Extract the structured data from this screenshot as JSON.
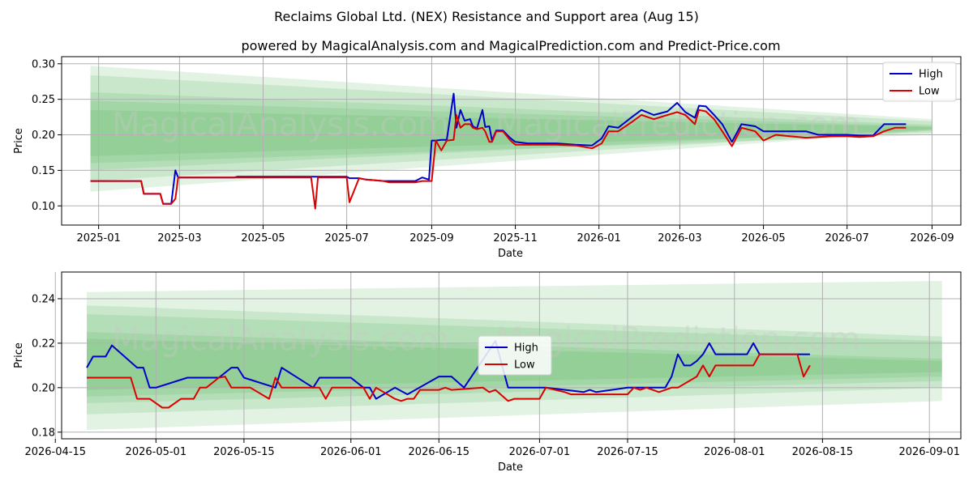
{
  "title": "Reclaims Global Ltd. (NEX) Resistance and Support area (Aug 15)",
  "subtitle": "powered by MagicalAnalysis.com and MagicalPrediction.com and Predict-Price.com",
  "watermarks": [
    "MagicalAnalysis.com",
    "MagicalPrediction.com"
  ],
  "colors": {
    "high": "#0000cc",
    "low": "#dd0000",
    "band": "#4caf50",
    "grid": "#b0b0b0"
  },
  "chart_data": [
    {
      "type": "line",
      "xlabel": "Date",
      "ylabel": "Price",
      "xlim": [
        "2024-12-05",
        "2026-09-22"
      ],
      "ylim": [
        0.073,
        0.31
      ],
      "x_ticks": [
        "2025-01",
        "2025-03",
        "2025-05",
        "2025-07",
        "2025-09",
        "2025-11",
        "2026-01",
        "2026-03",
        "2026-05",
        "2026-07",
        "2026-09"
      ],
      "y_ticks": [
        0.1,
        0.15,
        0.2,
        0.25,
        0.3
      ],
      "y_tick_labels": [
        "0.10",
        "0.15",
        "0.20",
        "0.25",
        "0.30"
      ],
      "grid": true,
      "legend": {
        "position": "top-right",
        "entries": [
          "High",
          "Low"
        ]
      },
      "bands": {
        "x": [
          "2024-12-26",
          "2026-09-01"
        ],
        "upper": [
          [
            0.297,
            0.222
          ],
          [
            0.284,
            0.219
          ],
          [
            0.26,
            0.214
          ],
          [
            0.248,
            0.212
          ],
          [
            0.235,
            0.211
          ]
        ],
        "lower": [
          [
            0.12,
            0.206
          ],
          [
            0.135,
            0.207
          ],
          [
            0.15,
            0.208
          ],
          [
            0.16,
            0.2
          ],
          [
            0.17,
            0.203
          ]
        ]
      },
      "series": [
        {
          "name": "High",
          "x": [
            "2024-12-26",
            "2025-02-01",
            "2025-02-03",
            "2025-02-15",
            "2025-02-17",
            "2025-02-23",
            "2025-02-26",
            "2025-02-28",
            "2025-04-10",
            "2025-04-12",
            "2025-06-05",
            "2025-06-08",
            "2025-06-10",
            "2025-07-01",
            "2025-07-03",
            "2025-07-10",
            "2025-07-15",
            "2025-07-28",
            "2025-08-01",
            "2025-08-20",
            "2025-08-25",
            "2025-08-30",
            "2025-09-01",
            "2025-09-04",
            "2025-09-08",
            "2025-09-12",
            "2025-09-17",
            "2025-09-19",
            "2025-09-22",
            "2025-09-25",
            "2025-09-29",
            "2025-10-01",
            "2025-10-04",
            "2025-10-08",
            "2025-10-10",
            "2025-10-13",
            "2025-10-15",
            "2025-10-18",
            "2025-10-23",
            "2025-10-28",
            "2025-11-01",
            "2025-11-10",
            "2025-11-20",
            "2025-12-01",
            "2025-12-15",
            "2025-12-27",
            "2026-01-03",
            "2026-01-08",
            "2026-01-15",
            "2026-01-25",
            "2026-02-01",
            "2026-02-10",
            "2026-02-20",
            "2026-02-27",
            "2026-03-05",
            "2026-03-12",
            "2026-03-15",
            "2026-03-20",
            "2026-03-26",
            "2026-04-01",
            "2026-04-08",
            "2026-04-15",
            "2026-04-25",
            "2026-05-01",
            "2026-05-10",
            "2026-05-20",
            "2026-06-01",
            "2026-06-10",
            "2026-06-20",
            "2026-07-01",
            "2026-07-10",
            "2026-07-20",
            "2026-07-28",
            "2026-08-05",
            "2026-08-10",
            "2026-08-13"
          ],
          "y": [
            0.135,
            0.135,
            0.117,
            0.117,
            0.103,
            0.103,
            0.15,
            0.14,
            0.14,
            0.141,
            0.141,
            0.141,
            0.141,
            0.141,
            0.139,
            0.139,
            0.137,
            0.135,
            0.135,
            0.135,
            0.14,
            0.137,
            0.192,
            0.192,
            0.193,
            0.193,
            0.258,
            0.21,
            0.235,
            0.22,
            0.222,
            0.212,
            0.209,
            0.235,
            0.211,
            0.212,
            0.192,
            0.206,
            0.206,
            0.196,
            0.19,
            0.188,
            0.188,
            0.188,
            0.186,
            0.185,
            0.195,
            0.212,
            0.21,
            0.225,
            0.235,
            0.228,
            0.233,
            0.245,
            0.232,
            0.224,
            0.241,
            0.24,
            0.228,
            0.215,
            0.19,
            0.215,
            0.212,
            0.205,
            0.205,
            0.205,
            0.205,
            0.2,
            0.2,
            0.2,
            0.199,
            0.199,
            0.215,
            0.215,
            0.215,
            0.215
          ]
        },
        {
          "name": "Low",
          "x": [
            "2024-12-26",
            "2025-02-01",
            "2025-02-03",
            "2025-02-15",
            "2025-02-17",
            "2025-02-23",
            "2025-02-26",
            "2025-02-28",
            "2025-04-10",
            "2025-04-12",
            "2025-06-05",
            "2025-06-08",
            "2025-06-10",
            "2025-07-01",
            "2025-07-03",
            "2025-07-10",
            "2025-07-15",
            "2025-07-28",
            "2025-08-01",
            "2025-08-20",
            "2025-08-25",
            "2025-08-30",
            "2025-09-01",
            "2025-09-04",
            "2025-09-08",
            "2025-09-12",
            "2025-09-17",
            "2025-09-19",
            "2025-09-22",
            "2025-09-25",
            "2025-09-29",
            "2025-10-01",
            "2025-10-04",
            "2025-10-08",
            "2025-10-10",
            "2025-10-13",
            "2025-10-15",
            "2025-10-18",
            "2025-10-23",
            "2025-10-28",
            "2025-11-01",
            "2025-11-10",
            "2025-11-20",
            "2025-12-01",
            "2025-12-15",
            "2025-12-27",
            "2026-01-03",
            "2026-01-08",
            "2026-01-15",
            "2026-01-25",
            "2026-02-01",
            "2026-02-10",
            "2026-02-20",
            "2026-02-27",
            "2026-03-05",
            "2026-03-12",
            "2026-03-15",
            "2026-03-20",
            "2026-03-26",
            "2026-04-01",
            "2026-04-08",
            "2026-04-15",
            "2026-04-25",
            "2026-05-01",
            "2026-05-10",
            "2026-05-20",
            "2026-06-01",
            "2026-06-10",
            "2026-06-20",
            "2026-07-01",
            "2026-07-10",
            "2026-07-20",
            "2026-07-28",
            "2026-08-05",
            "2026-08-10",
            "2026-08-13"
          ],
          "y": [
            0.135,
            0.135,
            0.117,
            0.117,
            0.103,
            0.103,
            0.11,
            0.14,
            0.14,
            0.14,
            0.14,
            0.096,
            0.14,
            0.14,
            0.105,
            0.139,
            0.137,
            0.135,
            0.133,
            0.133,
            0.135,
            0.135,
            0.135,
            0.192,
            0.178,
            0.192,
            0.193,
            0.228,
            0.21,
            0.215,
            0.215,
            0.21,
            0.208,
            0.21,
            0.205,
            0.19,
            0.19,
            0.205,
            0.205,
            0.193,
            0.186,
            0.186,
            0.186,
            0.186,
            0.185,
            0.181,
            0.188,
            0.205,
            0.205,
            0.218,
            0.228,
            0.222,
            0.228,
            0.232,
            0.228,
            0.215,
            0.235,
            0.233,
            0.222,
            0.205,
            0.184,
            0.21,
            0.205,
            0.192,
            0.2,
            0.198,
            0.196,
            0.197,
            0.198,
            0.198,
            0.197,
            0.198,
            0.205,
            0.21,
            0.21,
            0.21
          ]
        }
      ]
    },
    {
      "type": "line",
      "xlabel": "Date",
      "ylabel": "Price",
      "xlim": [
        "2026-04-16",
        "2026-09-06"
      ],
      "ylim": [
        0.177,
        0.252
      ],
      "x_ticks": [
        "2026-04-15",
        "2026-05-01",
        "2026-05-15",
        "2026-06-01",
        "2026-06-15",
        "2026-07-01",
        "2026-07-15",
        "2026-08-01",
        "2026-08-15",
        "2026-09-01"
      ],
      "y_ticks": [
        0.18,
        0.2,
        0.22,
        0.24
      ],
      "y_tick_labels": [
        "0.18",
        "0.20",
        "0.22",
        "0.24"
      ],
      "grid": true,
      "legend": {
        "position": "center",
        "entries": [
          "High",
          "Low"
        ]
      },
      "bands": {
        "x": [
          "2026-04-20",
          "2026-09-03"
        ],
        "upper": [
          [
            0.243,
            0.248
          ],
          [
            0.237,
            0.223
          ],
          [
            0.233,
            0.221
          ],
          [
            0.225,
            0.213
          ],
          [
            0.222,
            0.212
          ]
        ],
        "lower": [
          [
            0.199,
            0.207
          ],
          [
            0.196,
            0.205
          ],
          [
            0.193,
            0.203
          ],
          [
            0.188,
            0.2
          ],
          [
            0.181,
            0.194
          ]
        ]
      },
      "series": [
        {
          "name": "High",
          "x": [
            "2026-04-20",
            "2026-04-21",
            "2026-04-23",
            "2026-04-24",
            "2026-04-28",
            "2026-04-29",
            "2026-04-30",
            "2026-05-01",
            "2026-05-06",
            "2026-05-11",
            "2026-05-13",
            "2026-05-14",
            "2026-05-15",
            "2026-05-20",
            "2026-05-21",
            "2026-05-26",
            "2026-05-27",
            "2026-06-01",
            "2026-06-03",
            "2026-06-04",
            "2026-06-05",
            "2026-06-08",
            "2026-06-10",
            "2026-06-15",
            "2026-06-17",
            "2026-06-19",
            "2026-06-24",
            "2026-06-26",
            "2026-07-02",
            "2026-07-08",
            "2026-07-09",
            "2026-07-10",
            "2026-07-15",
            "2026-07-16",
            "2026-07-20",
            "2026-07-21",
            "2026-07-22",
            "2026-07-23",
            "2026-07-24",
            "2026-07-25",
            "2026-07-26",
            "2026-07-27",
            "2026-07-28",
            "2026-07-29",
            "2026-08-03",
            "2026-08-04",
            "2026-08-05",
            "2026-08-06",
            "2026-08-10",
            "2026-08-11",
            "2026-08-12",
            "2026-08-13"
          ],
          "y": [
            0.209,
            0.214,
            0.214,
            0.219,
            0.209,
            0.209,
            0.2,
            0.2,
            0.2045,
            0.2045,
            0.209,
            0.209,
            0.2045,
            0.2,
            0.209,
            0.2,
            0.2045,
            0.2045,
            0.2,
            0.2,
            0.195,
            0.2,
            0.197,
            0.205,
            0.205,
            0.2,
            0.221,
            0.2,
            0.2,
            0.198,
            0.199,
            0.198,
            0.2,
            0.2,
            0.2,
            0.2,
            0.205,
            0.215,
            0.21,
            0.21,
            0.212,
            0.215,
            0.22,
            0.215,
            0.215,
            0.22,
            0.215,
            0.215,
            0.215,
            0.215,
            0.215,
            0.215
          ]
        },
        {
          "name": "Low",
          "x": [
            "2026-04-20",
            "2026-04-25",
            "2026-04-27",
            "2026-04-28",
            "2026-04-29",
            "2026-04-30",
            "2026-05-02",
            "2026-05-03",
            "2026-05-05",
            "2026-05-06",
            "2026-05-07",
            "2026-05-08",
            "2026-05-09",
            "2026-05-11",
            "2026-05-12",
            "2026-05-13",
            "2026-05-14",
            "2026-05-15",
            "2026-05-16",
            "2026-05-19",
            "2026-05-20",
            "2026-05-21",
            "2026-05-27",
            "2026-05-28",
            "2026-05-29",
            "2026-06-03",
            "2026-06-04",
            "2026-06-05",
            "2026-06-08",
            "2026-06-09",
            "2026-06-10",
            "2026-06-11",
            "2026-06-12",
            "2026-06-15",
            "2026-06-16",
            "2026-06-17",
            "2026-06-22",
            "2026-06-23",
            "2026-06-24",
            "2026-06-26",
            "2026-06-27",
            "2026-07-01",
            "2026-07-02",
            "2026-07-05",
            "2026-07-06",
            "2026-07-09",
            "2026-07-12",
            "2026-07-15",
            "2026-07-16",
            "2026-07-17",
            "2026-07-18",
            "2026-07-20",
            "2026-07-21",
            "2026-07-22",
            "2026-07-23",
            "2026-07-26",
            "2026-07-27",
            "2026-07-28",
            "2026-07-29",
            "2026-08-03",
            "2026-08-04",
            "2026-08-05",
            "2026-08-10",
            "2026-08-11",
            "2026-08-12",
            "2026-08-13"
          ],
          "y": [
            0.2045,
            0.2045,
            0.2045,
            0.195,
            0.195,
            0.195,
            0.191,
            0.191,
            0.195,
            0.195,
            0.195,
            0.2,
            0.2,
            0.2045,
            0.205,
            0.2,
            0.2,
            0.2,
            0.2,
            0.195,
            0.2045,
            0.2,
            0.2,
            0.195,
            0.2,
            0.2,
            0.195,
            0.2,
            0.195,
            0.194,
            0.195,
            0.195,
            0.199,
            0.199,
            0.2,
            0.199,
            0.2,
            0.198,
            0.199,
            0.194,
            0.195,
            0.195,
            0.2,
            0.198,
            0.197,
            0.197,
            0.197,
            0.197,
            0.2,
            0.199,
            0.2,
            0.198,
            0.199,
            0.2,
            0.2,
            0.205,
            0.21,
            0.205,
            0.21,
            0.21,
            0.21,
            0.215,
            0.215,
            0.215,
            0.205,
            0.21
          ]
        }
      ]
    }
  ]
}
